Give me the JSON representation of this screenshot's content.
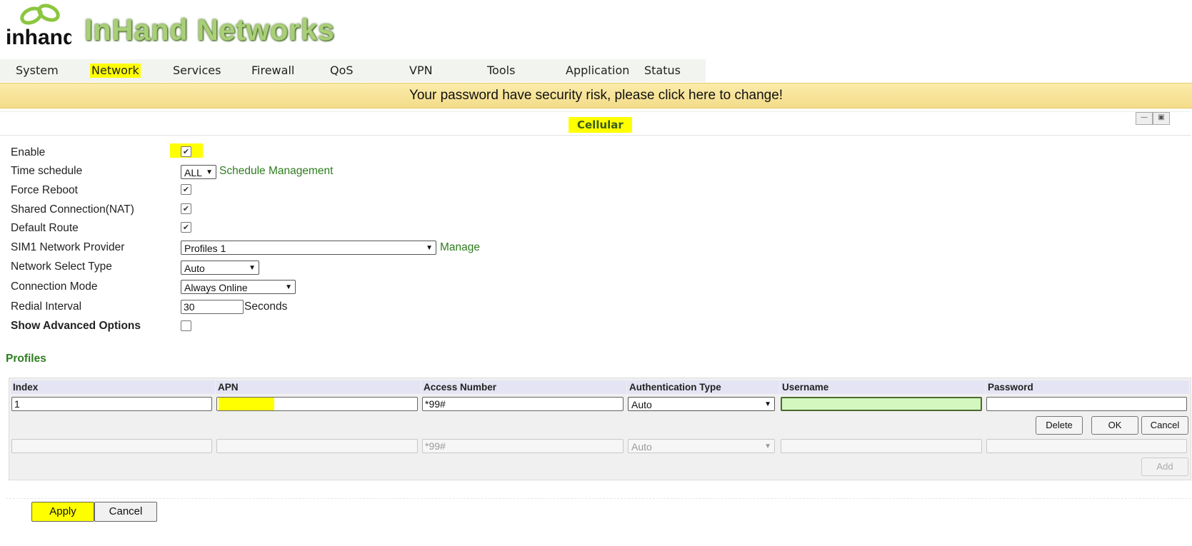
{
  "brand": {
    "logo_text": "inhand",
    "name": "InHand Networks"
  },
  "nav": [
    {
      "label": "System"
    },
    {
      "label": "Network",
      "active": true
    },
    {
      "label": "Services"
    },
    {
      "label": "Firewall"
    },
    {
      "label": "QoS"
    },
    {
      "label": "VPN"
    },
    {
      "label": "Tools"
    },
    {
      "label": "Application"
    },
    {
      "label": "Status"
    }
  ],
  "banner": {
    "text": "Your password have security risk, please click here to change!"
  },
  "panel": {
    "title": "Cellular"
  },
  "form": {
    "enable": {
      "label": "Enable",
      "checked": true
    },
    "time_schedule": {
      "label": "Time schedule",
      "value": "ALL",
      "link": "Schedule Management"
    },
    "force_reboot": {
      "label": "Force Reboot",
      "checked": true
    },
    "shared_connection": {
      "label": "Shared Connection(NAT)",
      "checked": true
    },
    "default_route": {
      "label": "Default Route",
      "checked": true
    },
    "sim1_provider": {
      "label": "SIM1 Network Provider",
      "value": "Profiles 1",
      "link": "Manage"
    },
    "network_select_type": {
      "label": "Network Select Type",
      "value": "Auto"
    },
    "connection_mode": {
      "label": "Connection Mode",
      "value": "Always Online"
    },
    "redial_interval": {
      "label": "Redial Interval",
      "value": "30",
      "unit": "Seconds"
    },
    "show_advanced": {
      "label": "Show Advanced Options",
      "checked": false
    }
  },
  "profiles": {
    "title": "Profiles",
    "columns": [
      "Index",
      "APN",
      "Access Number",
      "Authentication Type",
      "Username",
      "Password"
    ],
    "edit_row": {
      "index": "1",
      "apn": "",
      "access_number": "*99#",
      "auth_type": "Auto",
      "username": "",
      "password": ""
    },
    "row_buttons": {
      "delete": "Delete",
      "ok": "OK",
      "cancel": "Cancel"
    },
    "new_row": {
      "index": "",
      "apn": "",
      "access_number": "*99#",
      "auth_type": "Auto",
      "username": "",
      "password": ""
    },
    "add_button": "Add"
  },
  "actions": {
    "apply": "Apply",
    "cancel": "Cancel"
  },
  "colors": {
    "highlight": "#ffff00",
    "link_green": "#2e7d1e",
    "banner": "#f7e29a",
    "username_field": "#d4f7c0"
  },
  "icons": {
    "minimize": "minimize-icon",
    "maximize": "maximize-icon",
    "checkbox": "checkmark-icon",
    "dropdown": "chevron-down-icon"
  }
}
